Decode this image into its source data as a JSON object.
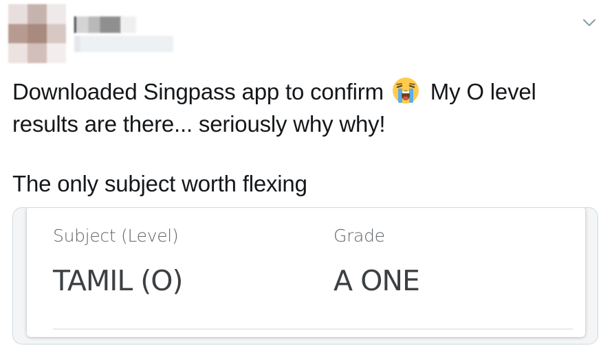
{
  "tweet": {
    "line1_before_emoji": "Downloaded Singpass app to confirm",
    "emoji_icon": "loudly-crying-face-icon",
    "line1_after_emoji": "My O level",
    "line2": "results are there... seriously why why!",
    "line3": "The only subject worth flexing"
  },
  "media": {
    "subject_header": "Subject (Level)",
    "grade_header": "Grade",
    "subject_value": "TAMIL (O)",
    "grade_value": "A ONE"
  },
  "icons": {
    "more_options": "chevron-down-icon"
  },
  "colors": {
    "text": "#14171a",
    "muted": "#5f6368",
    "border": "#cfd9de"
  }
}
